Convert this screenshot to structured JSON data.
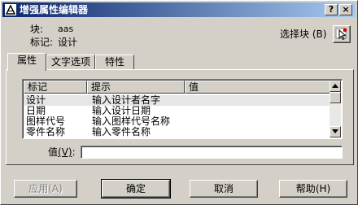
{
  "window": {
    "title": "增强属性编辑器",
    "help_button": "?",
    "close_button": "×"
  },
  "block": {
    "block_label": "块:",
    "block_value": "aas",
    "tag_label": "标记:",
    "tag_value": "设计",
    "select_block_text": "选择块",
    "select_block_mnemonic": "(B)"
  },
  "tabs": [
    {
      "label": "属性",
      "active": true
    },
    {
      "label": "文字选项",
      "active": false
    },
    {
      "label": "特性",
      "active": false
    }
  ],
  "attributes": {
    "columns": [
      "标记",
      "提示",
      "值"
    ],
    "rows": [
      {
        "tag": "设计",
        "prompt": "输入设计者名字",
        "value": "",
        "selected": true
      },
      {
        "tag": "日期",
        "prompt": "输入设计日期",
        "value": "",
        "selected": false
      },
      {
        "tag": "图样代号",
        "prompt": "输入图样代号名称",
        "value": "",
        "selected": false
      },
      {
        "tag": "零件名称",
        "prompt": "输入零件名称",
        "value": "",
        "selected": false
      }
    ]
  },
  "value_field": {
    "label_text": "值",
    "label_mnemonic": "(V)",
    "label_suffix": ":",
    "value": ""
  },
  "buttons": {
    "apply": "应用",
    "apply_mnemonic": "(A)",
    "ok": "确定",
    "cancel": "取消",
    "help": "帮助",
    "help_mnemonic": "(H)"
  }
}
